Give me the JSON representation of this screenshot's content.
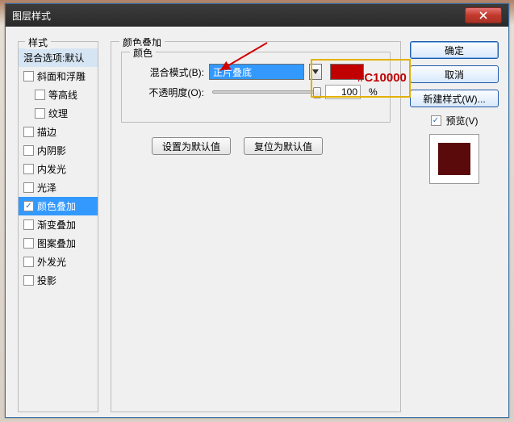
{
  "window": {
    "title": "图层样式"
  },
  "styles_panel": {
    "title": "样式",
    "blend_options": "混合选项:默认",
    "items": [
      {
        "label": "斜面和浮雕",
        "checked": false
      },
      {
        "label": "等高线",
        "checked": false,
        "indent": true
      },
      {
        "label": "纹理",
        "checked": false,
        "indent": true
      },
      {
        "label": "描边",
        "checked": false
      },
      {
        "label": "内阴影",
        "checked": false
      },
      {
        "label": "内发光",
        "checked": false
      },
      {
        "label": "光泽",
        "checked": false
      },
      {
        "label": "颜色叠加",
        "checked": true,
        "selected": true
      },
      {
        "label": "渐变叠加",
        "checked": false
      },
      {
        "label": "图案叠加",
        "checked": false
      },
      {
        "label": "外发光",
        "checked": false
      },
      {
        "label": "投影",
        "checked": false
      }
    ]
  },
  "details": {
    "title": "颜色叠加",
    "color_group": "颜色",
    "blend_mode_label": "混合模式(B):",
    "blend_mode_value": "正片叠底",
    "opacity_label": "不透明度(O):",
    "opacity_value": "100",
    "opacity_unit": "%",
    "btn_default": "设置为默认值",
    "btn_reset": "复位为默认值"
  },
  "right": {
    "ok": "确定",
    "cancel": "取消",
    "new_style": "新建样式(W)...",
    "preview_label": "预览(V)"
  },
  "annotation": {
    "hex": "#C10000",
    "color_value": "#c10000",
    "preview_color": "#5a0a0a"
  }
}
